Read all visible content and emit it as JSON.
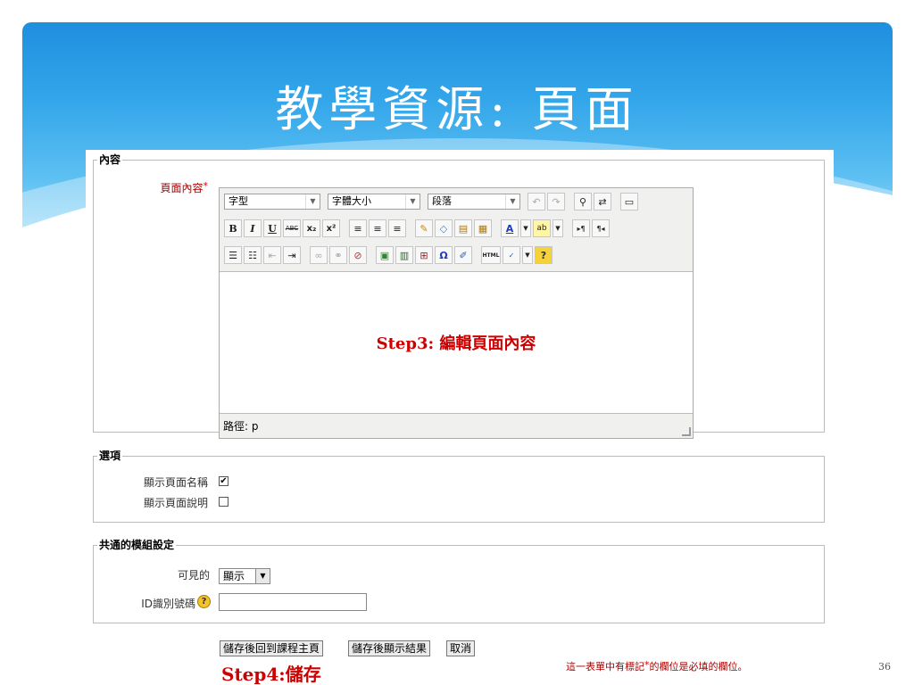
{
  "slide": {
    "title": "教學資源: 頁面",
    "page_number": "36"
  },
  "content_section": {
    "legend": "內容",
    "label": "頁面內容",
    "required_mark": "*",
    "editor": {
      "font_select": "字型",
      "size_select": "字體大小",
      "format_select": "段落",
      "body_annotation": "Step3: 編輯頁面內容",
      "path_label": "路徑: p",
      "bold": "B",
      "italic": "I",
      "underline": "U",
      "strike": "ABC",
      "subscript": "x₂",
      "superscript": "x²",
      "font_color": "A",
      "html_button": "HTML",
      "help_button": "?",
      "omega": "Ω"
    }
  },
  "options_section": {
    "legend": "選項",
    "show_name_label": "顯示頁面名稱",
    "show_name_checked": true,
    "show_desc_label": "顯示頁面說明",
    "show_desc_checked": false
  },
  "common_section": {
    "legend": "共通的模組設定",
    "visible_label": "可見的",
    "visible_value": "顯示",
    "id_label": "ID識別號碼",
    "id_value": ""
  },
  "footer": {
    "save_return_label": "儲存後回到課程主頁",
    "save_display_label": "儲存後顯示結果",
    "cancel_label": "取消",
    "step4": "Step4:儲存",
    "required_note_pre": "這一表單中有標記",
    "required_note_star": "*",
    "required_note_post": "的欄位是必填的欄位。"
  },
  "colors": {
    "band_top": "#1f8fde",
    "band_bottom": "#a8e0fa",
    "annotation_red": "#cc0000"
  }
}
